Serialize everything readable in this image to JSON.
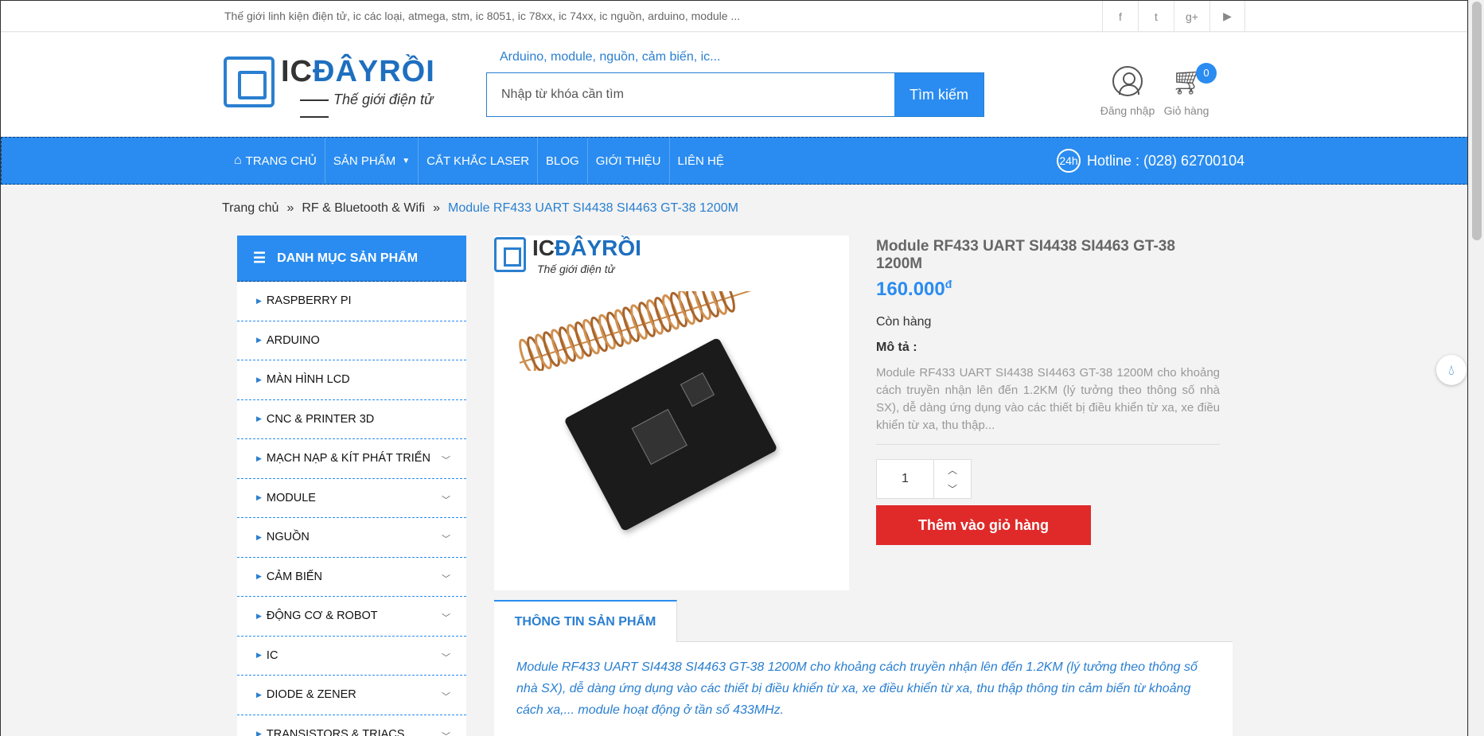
{
  "topbar": {
    "tagline": "Thế giới linh kiện điện tử, ic các loại, atmega, stm, ic 8051, ic 78xx, ic 74xx, ic nguồn, arduino, module ...",
    "social": [
      "f",
      "t",
      "g+",
      "▶"
    ]
  },
  "header": {
    "logo_brand_ic": "IC",
    "logo_brand_rest": "ĐÂYRỒI",
    "logo_slogan": "Thế giới điện tử",
    "search_hint": "Arduino, module, nguồn, cảm biến, ic...",
    "search_placeholder": "Nhập từ khóa cần tìm",
    "search_button": "Tìm kiếm",
    "login_label": "Đăng nhập",
    "cart_label": "Giỏ hàng",
    "cart_count": "0"
  },
  "nav": {
    "items": [
      "TRANG CHỦ",
      "SẢN PHẨM",
      "CẮT KHẮC LASER",
      "BLOG",
      "GIỚI THIỆU",
      "LIÊN HỆ"
    ],
    "hotline": "Hotline : (028) 62700104",
    "hotline_icon_text": "24h"
  },
  "breadcrumb": {
    "home": "Trang chủ",
    "sep": "»",
    "category": "RF & Bluetooth & Wifi",
    "current": "Module RF433 UART SI4438 SI4463 GT-38 1200M"
  },
  "sidebar": {
    "title": "DANH MỤC SẢN PHẨM",
    "categories": [
      {
        "label": "RASPBERRY PI",
        "expandable": false
      },
      {
        "label": "ARDUINO",
        "expandable": false
      },
      {
        "label": "MÀN HÌNH LCD",
        "expandable": false
      },
      {
        "label": "CNC & PRINTER 3D",
        "expandable": false
      },
      {
        "label": "MẠCH NẠP & KÍT PHÁT TRIỂN",
        "expandable": true
      },
      {
        "label": "MODULE",
        "expandable": true
      },
      {
        "label": "NGUỒN",
        "expandable": true
      },
      {
        "label": "CẢM BIẾN",
        "expandable": true
      },
      {
        "label": "ĐỘNG CƠ & ROBOT",
        "expandable": true
      },
      {
        "label": "IC",
        "expandable": true
      },
      {
        "label": "DIODE & ZENER",
        "expandable": true
      },
      {
        "label": "TRANSISTORS & TRIACS",
        "expandable": true
      }
    ]
  },
  "product": {
    "image_logo_ic": "IC",
    "image_logo_rest": "ĐÂYRỒI",
    "image_logo_slogan": "Thế giới điện tử",
    "title": "Module RF433 UART SI4438 SI4463 GT-38 1200M",
    "price": "160.000",
    "currency": "đ",
    "stock": "Còn hàng",
    "desc_label": "Mô tả :",
    "desc": "Module RF433 UART SI4438 SI4463 GT-38 1200M cho khoảng cách truyền nhận lên đến 1.2KM (lý tưởng theo thông số nhà SX), dễ dàng ứng dụng vào các thiết bị điều khiển từ xa, xe điều khiển từ xa, thu thập...",
    "quantity": "1",
    "add_to_cart": "Thêm vào giỏ hàng"
  },
  "tabs": {
    "active": "THÔNG TIN SẢN PHẨM",
    "body": "Module RF433 UART SI4438 SI4463 GT-38 1200M cho khoảng cách truyền nhận lên đến 1.2KM (lý tưởng theo thông số nhà SX), dễ dàng ứng dụng vào các thiết bị điều khiển từ xa, xe điều khiển từ xa, thu thập thông tin cảm biến từ khoảng cách xa,... module hoạt động ở tần số 433MHz."
  },
  "colors": {
    "accent": "#2a8cf0",
    "cta": "#e02a2a"
  }
}
